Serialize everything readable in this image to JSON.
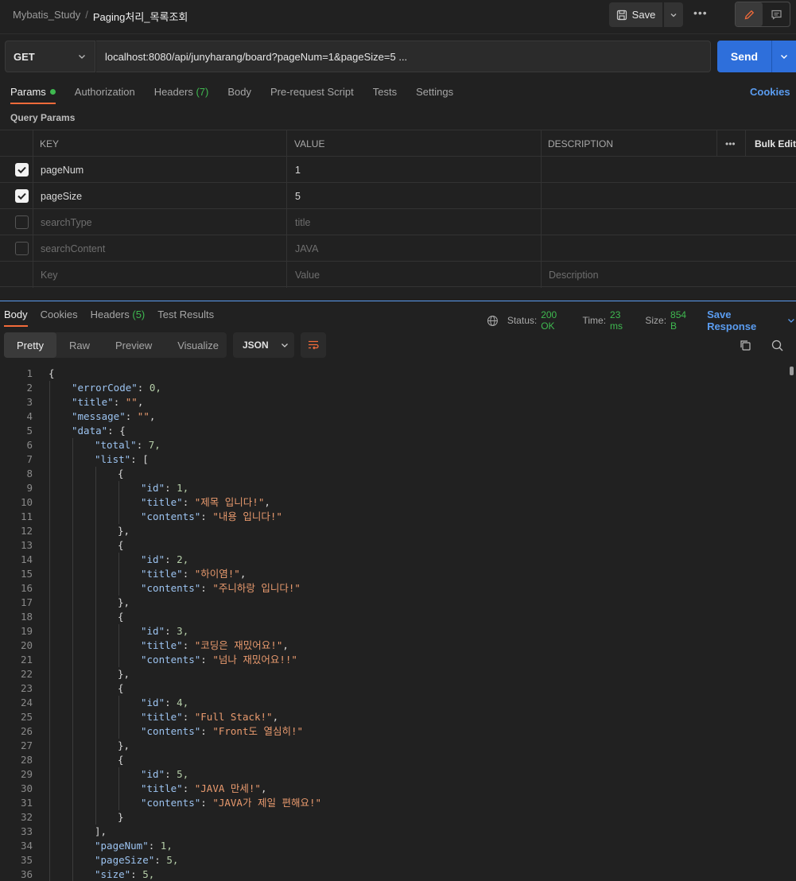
{
  "header": {
    "workspace": "Mybatis_Study",
    "separator": "/",
    "request_name": "Paging처리_목록조회",
    "save_label": "Save",
    "more_label": "•••"
  },
  "request": {
    "method": "GET",
    "url": "localhost:8080/api/junyharang/board?pageNum=1&pageSize=5 ...",
    "send_label": "Send"
  },
  "req_tabs": {
    "params": "Params",
    "authorization": "Authorization",
    "headers": "Headers",
    "headers_count": "(7)",
    "body": "Body",
    "prerequest": "Pre-request Script",
    "tests": "Tests",
    "settings": "Settings",
    "cookies": "Cookies"
  },
  "query_params": {
    "label": "Query Params",
    "columns": {
      "key": "KEY",
      "value": "VALUE",
      "description": "DESCRIPTION",
      "more": "•••",
      "bulk_edit": "Bulk Edit"
    },
    "rows": [
      {
        "key": "pageNum",
        "value": "1",
        "checked": true
      },
      {
        "key": "pageSize",
        "value": "5",
        "checked": true
      },
      {
        "key": "searchType",
        "value": "title",
        "checked": false
      },
      {
        "key": "searchContent",
        "value": "JAVA",
        "checked": false
      }
    ],
    "placeholders": {
      "key": "Key",
      "value": "Value",
      "description": "Description"
    }
  },
  "response": {
    "tabs": {
      "body": "Body",
      "cookies": "Cookies",
      "headers": "Headers",
      "headers_count": "(5)",
      "test_results": "Test Results"
    },
    "status_label": "Status:",
    "status": "200 OK",
    "time_label": "Time:",
    "time": "23 ms",
    "size_label": "Size:",
    "size": "854 B",
    "save_response": "Save Response",
    "views": {
      "pretty": "Pretty",
      "raw": "Raw",
      "preview": "Preview",
      "visualize": "Visualize"
    },
    "format": "JSON"
  },
  "code_lines": [
    {
      "n": "1",
      "i": 0,
      "t": "{"
    },
    {
      "n": "2",
      "i": 1,
      "k": "\"errorCode\"",
      "v": "0,",
      "vt": "n"
    },
    {
      "n": "3",
      "i": 1,
      "k": "\"title\"",
      "v": "\"\"",
      "vt": "s",
      "tail": ","
    },
    {
      "n": "4",
      "i": 1,
      "k": "\"message\"",
      "v": "\"\"",
      "vt": "s",
      "tail": ","
    },
    {
      "n": "5",
      "i": 1,
      "k": "\"data\"",
      "v": "{",
      "vt": "p"
    },
    {
      "n": "6",
      "i": 2,
      "k": "\"total\"",
      "v": "7,",
      "vt": "n"
    },
    {
      "n": "7",
      "i": 2,
      "k": "\"list\"",
      "v": "[",
      "vt": "p"
    },
    {
      "n": "8",
      "i": 3,
      "t": "{"
    },
    {
      "n": "9",
      "i": 4,
      "k": "\"id\"",
      "v": "1,",
      "vt": "n"
    },
    {
      "n": "10",
      "i": 4,
      "k": "\"title\"",
      "v": "\"제목 입니다!\"",
      "vt": "s",
      "tail": ","
    },
    {
      "n": "11",
      "i": 4,
      "k": "\"contents\"",
      "v": "\"내용 입니다!\"",
      "vt": "s"
    },
    {
      "n": "12",
      "i": 3,
      "t": "},"
    },
    {
      "n": "13",
      "i": 3,
      "t": "{"
    },
    {
      "n": "14",
      "i": 4,
      "k": "\"id\"",
      "v": "2,",
      "vt": "n"
    },
    {
      "n": "15",
      "i": 4,
      "k": "\"title\"",
      "v": "\"하이염!\"",
      "vt": "s",
      "tail": ","
    },
    {
      "n": "16",
      "i": 4,
      "k": "\"contents\"",
      "v": "\"주니하랑 입니다!\"",
      "vt": "s"
    },
    {
      "n": "17",
      "i": 3,
      "t": "},"
    },
    {
      "n": "18",
      "i": 3,
      "t": "{"
    },
    {
      "n": "19",
      "i": 4,
      "k": "\"id\"",
      "v": "3,",
      "vt": "n"
    },
    {
      "n": "20",
      "i": 4,
      "k": "\"title\"",
      "v": "\"코딩은 재밌어요!\"",
      "vt": "s",
      "tail": ","
    },
    {
      "n": "21",
      "i": 4,
      "k": "\"contents\"",
      "v": "\"넘나 재밌어요!!\"",
      "vt": "s"
    },
    {
      "n": "22",
      "i": 3,
      "t": "},"
    },
    {
      "n": "23",
      "i": 3,
      "t": "{"
    },
    {
      "n": "24",
      "i": 4,
      "k": "\"id\"",
      "v": "4,",
      "vt": "n"
    },
    {
      "n": "25",
      "i": 4,
      "k": "\"title\"",
      "v": "\"Full Stack!\"",
      "vt": "s",
      "tail": ","
    },
    {
      "n": "26",
      "i": 4,
      "k": "\"contents\"",
      "v": "\"Front도 열심히!\"",
      "vt": "s"
    },
    {
      "n": "27",
      "i": 3,
      "t": "},"
    },
    {
      "n": "28",
      "i": 3,
      "t": "{"
    },
    {
      "n": "29",
      "i": 4,
      "k": "\"id\"",
      "v": "5,",
      "vt": "n"
    },
    {
      "n": "30",
      "i": 4,
      "k": "\"title\"",
      "v": "\"JAVA 만세!\"",
      "vt": "s",
      "tail": ","
    },
    {
      "n": "31",
      "i": 4,
      "k": "\"contents\"",
      "v": "\"JAVA가 제일 편해요!\"",
      "vt": "s"
    },
    {
      "n": "32",
      "i": 3,
      "t": "}"
    },
    {
      "n": "33",
      "i": 2,
      "t": "],"
    },
    {
      "n": "34",
      "i": 2,
      "k": "\"pageNum\"",
      "v": "1,",
      "vt": "n"
    },
    {
      "n": "35",
      "i": 2,
      "k": "\"pageSize\"",
      "v": "5,",
      "vt": "n"
    },
    {
      "n": "36",
      "i": 2,
      "k": "\"size\"",
      "v": "5,",
      "vt": "n"
    }
  ]
}
